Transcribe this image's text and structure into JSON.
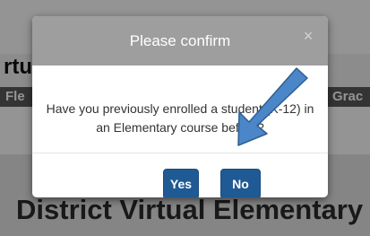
{
  "background": {
    "heading": "rtu",
    "bar_left": "Fle",
    "bar_right": "Grac",
    "school_name": "District Virtual Elementary"
  },
  "dialog": {
    "title": "Please confirm",
    "close_symbol": "×",
    "message": "Have you previously enrolled a student (K-12) in an Elementary course before?",
    "yes_label": "Yes",
    "no_label": "No"
  },
  "colors": {
    "header_gray": "#9e9e9e",
    "button_blue": "#1f5a94",
    "arrow_blue": "#4a86c8"
  }
}
